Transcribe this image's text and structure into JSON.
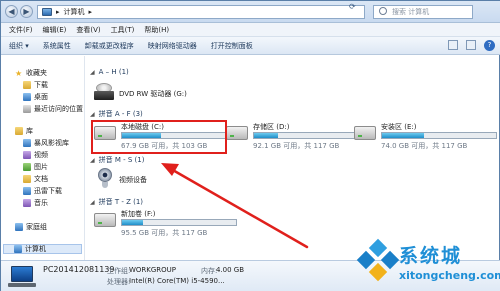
{
  "address_bar": {
    "path_separator": "▸",
    "path_label": "计算机",
    "search_placeholder": "搜索 计算机"
  },
  "menu": [
    "文件(F)",
    "编辑(E)",
    "查看(V)",
    "工具(T)",
    "帮助(H)"
  ],
  "toolbar": [
    "组织 ▾",
    "系统属性",
    "卸载或更改程序",
    "映射网络驱动器",
    "打开控制面板"
  ],
  "nav": {
    "favorites_label": "收藏夹",
    "favorites": [
      "下载",
      "桌面",
      "最近访问的位置"
    ],
    "libraries_label": "库",
    "libraries": [
      "暴风影视库",
      "视频",
      "图片",
      "文档",
      "迅雷下载",
      "音乐"
    ],
    "homegroup": "家庭组",
    "computer": "计算机"
  },
  "groups": {
    "g1": "A – H (1)",
    "g2": "拼音 A - F (3)",
    "g3": "拼音 M - S (1)",
    "g4": "拼音 T - Z (1)"
  },
  "drives": {
    "dvd": {
      "name": "DVD RW 驱动器 (G:)"
    },
    "c": {
      "name": "本地磁盘 (C:)",
      "sub": "67.9 GB 可用，共 103 GB",
      "used_fraction": 0.34
    },
    "d": {
      "name": "存储区 (D:)",
      "sub": "92.1 GB 可用，共 117 GB",
      "used_fraction": 0.21
    },
    "e": {
      "name": "安装区 (E:)",
      "sub": "74.0 GB 可用，共 117 GB",
      "used_fraction": 0.37
    },
    "cam": {
      "name": "视频设备"
    },
    "f": {
      "name": "新加卷 (F:)",
      "sub": "95.5 GB 可用，共 117 GB",
      "used_fraction": 0.18
    }
  },
  "details": {
    "pc_name": "PC201412081139",
    "workgroup_label": "工作组:",
    "workgroup": "WORKGROUP",
    "memory_label": "内存:",
    "memory": "4.00 GB",
    "processor_label": "处理器:",
    "processor": "Intel(R) Core(TM) i5-4590..."
  },
  "watermark": {
    "brand": "系统城",
    "url": "xitongcheng.com"
  },
  "colors": {
    "annotation": "#e0201c",
    "bar_fill": "#1f8ec9"
  }
}
